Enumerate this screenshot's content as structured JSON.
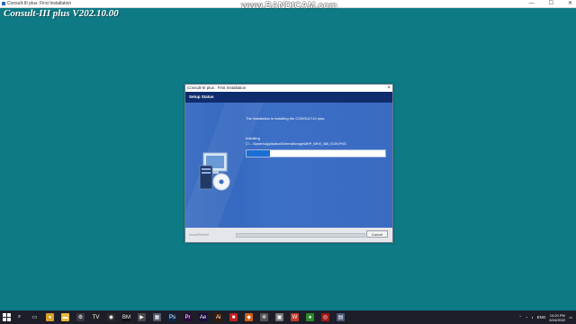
{
  "outer_window": {
    "title": "Consult-III plus: First Installation",
    "minimize_label": "—",
    "maximize_label": "☐",
    "close_label": "✕"
  },
  "overlay_title": "Consult-III plus V202.10.00",
  "recording_watermark": "www.BANDICAM.com",
  "installer": {
    "title": "Consult-III plus : First Installation",
    "close_label": "×",
    "header": "Setup Status",
    "message": "The installation is installing the CONSULT-III plus.",
    "status_label": "Installing",
    "current_file": "C:\\...\\System\\Application\\External\\Image\\MHP_IMH0_086_ICON.PNG",
    "progress_fraction": 0.17,
    "footer_brand": "InstallShield",
    "cancel_label": "Cancel"
  },
  "taskbar": {
    "icons": [
      {
        "name": "search-icon",
        "glyph": "⌕",
        "color": "#1e1e28"
      },
      {
        "name": "task-view-icon",
        "glyph": "▭",
        "color": "#1e1e28"
      },
      {
        "name": "chrome-icon",
        "glyph": "●",
        "color": "#d8a02a"
      },
      {
        "name": "file-explorer-icon",
        "glyph": "▬",
        "color": "#e8b838"
      },
      {
        "name": "settings-icon",
        "glyph": "⚙",
        "color": "#3a3a46"
      },
      {
        "name": "app-tv-icon",
        "glyph": "TV",
        "color": "#222"
      },
      {
        "name": "app-camera-icon",
        "glyph": "◉",
        "color": "#2a2a2a"
      },
      {
        "name": "app-bm-icon",
        "glyph": "BM",
        "color": "#111"
      },
      {
        "name": "app-media-icon",
        "glyph": "▶",
        "color": "#4a4a4a"
      },
      {
        "name": "app-grid-icon",
        "glyph": "▦",
        "color": "#505a6a"
      },
      {
        "name": "photoshop-icon",
        "glyph": "Ps",
        "color": "#0b2a4a"
      },
      {
        "name": "premiere-icon",
        "glyph": "Pr",
        "color": "#2a0a3a"
      },
      {
        "name": "after-effects-icon",
        "glyph": "Ae",
        "color": "#1a0a3a"
      },
      {
        "name": "illustrator-icon",
        "glyph": "Ai",
        "color": "#3a1a00"
      },
      {
        "name": "app-red-icon",
        "glyph": "■",
        "color": "#c02020"
      },
      {
        "name": "app-orange-icon",
        "glyph": "◆",
        "color": "#d06010"
      },
      {
        "name": "app-gear-icon",
        "glyph": "✲",
        "color": "#555"
      },
      {
        "name": "app-gray-icon",
        "glyph": "▣",
        "color": "#777"
      },
      {
        "name": "word-icon",
        "glyph": "W",
        "color": "#c03a2a"
      },
      {
        "name": "app-green-icon",
        "glyph": "●",
        "color": "#2a8a2a"
      },
      {
        "name": "app-record-icon",
        "glyph": "◎",
        "color": "#a01818"
      },
      {
        "name": "app-installer-icon",
        "glyph": "▤",
        "color": "#4a5a7a"
      }
    ],
    "tray": {
      "lang": "ENG",
      "time": "10:20 PM",
      "date": "8/24/2022"
    }
  }
}
